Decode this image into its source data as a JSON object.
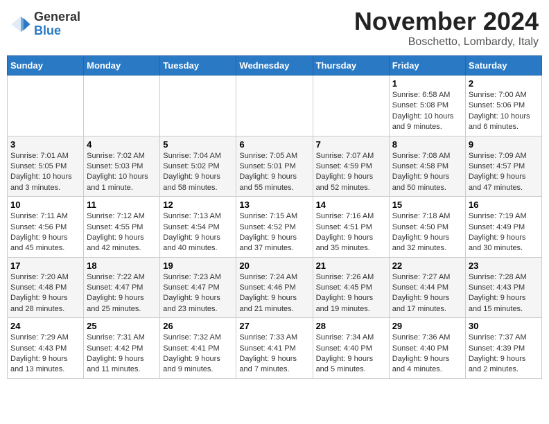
{
  "header": {
    "logo_line1": "General",
    "logo_line2": "Blue",
    "title": "November 2024",
    "subtitle": "Boschetto, Lombardy, Italy"
  },
  "calendar": {
    "days_of_week": [
      "Sunday",
      "Monday",
      "Tuesday",
      "Wednesday",
      "Thursday",
      "Friday",
      "Saturday"
    ],
    "weeks": [
      [
        {
          "day": "",
          "info": ""
        },
        {
          "day": "",
          "info": ""
        },
        {
          "day": "",
          "info": ""
        },
        {
          "day": "",
          "info": ""
        },
        {
          "day": "",
          "info": ""
        },
        {
          "day": "1",
          "info": "Sunrise: 6:58 AM\nSunset: 5:08 PM\nDaylight: 10 hours and 9 minutes."
        },
        {
          "day": "2",
          "info": "Sunrise: 7:00 AM\nSunset: 5:06 PM\nDaylight: 10 hours and 6 minutes."
        }
      ],
      [
        {
          "day": "3",
          "info": "Sunrise: 7:01 AM\nSunset: 5:05 PM\nDaylight: 10 hours and 3 minutes."
        },
        {
          "day": "4",
          "info": "Sunrise: 7:02 AM\nSunset: 5:03 PM\nDaylight: 10 hours and 1 minute."
        },
        {
          "day": "5",
          "info": "Sunrise: 7:04 AM\nSunset: 5:02 PM\nDaylight: 9 hours and 58 minutes."
        },
        {
          "day": "6",
          "info": "Sunrise: 7:05 AM\nSunset: 5:01 PM\nDaylight: 9 hours and 55 minutes."
        },
        {
          "day": "7",
          "info": "Sunrise: 7:07 AM\nSunset: 4:59 PM\nDaylight: 9 hours and 52 minutes."
        },
        {
          "day": "8",
          "info": "Sunrise: 7:08 AM\nSunset: 4:58 PM\nDaylight: 9 hours and 50 minutes."
        },
        {
          "day": "9",
          "info": "Sunrise: 7:09 AM\nSunset: 4:57 PM\nDaylight: 9 hours and 47 minutes."
        }
      ],
      [
        {
          "day": "10",
          "info": "Sunrise: 7:11 AM\nSunset: 4:56 PM\nDaylight: 9 hours and 45 minutes."
        },
        {
          "day": "11",
          "info": "Sunrise: 7:12 AM\nSunset: 4:55 PM\nDaylight: 9 hours and 42 minutes."
        },
        {
          "day": "12",
          "info": "Sunrise: 7:13 AM\nSunset: 4:54 PM\nDaylight: 9 hours and 40 minutes."
        },
        {
          "day": "13",
          "info": "Sunrise: 7:15 AM\nSunset: 4:52 PM\nDaylight: 9 hours and 37 minutes."
        },
        {
          "day": "14",
          "info": "Sunrise: 7:16 AM\nSunset: 4:51 PM\nDaylight: 9 hours and 35 minutes."
        },
        {
          "day": "15",
          "info": "Sunrise: 7:18 AM\nSunset: 4:50 PM\nDaylight: 9 hours and 32 minutes."
        },
        {
          "day": "16",
          "info": "Sunrise: 7:19 AM\nSunset: 4:49 PM\nDaylight: 9 hours and 30 minutes."
        }
      ],
      [
        {
          "day": "17",
          "info": "Sunrise: 7:20 AM\nSunset: 4:48 PM\nDaylight: 9 hours and 28 minutes."
        },
        {
          "day": "18",
          "info": "Sunrise: 7:22 AM\nSunset: 4:47 PM\nDaylight: 9 hours and 25 minutes."
        },
        {
          "day": "19",
          "info": "Sunrise: 7:23 AM\nSunset: 4:47 PM\nDaylight: 9 hours and 23 minutes."
        },
        {
          "day": "20",
          "info": "Sunrise: 7:24 AM\nSunset: 4:46 PM\nDaylight: 9 hours and 21 minutes."
        },
        {
          "day": "21",
          "info": "Sunrise: 7:26 AM\nSunset: 4:45 PM\nDaylight: 9 hours and 19 minutes."
        },
        {
          "day": "22",
          "info": "Sunrise: 7:27 AM\nSunset: 4:44 PM\nDaylight: 9 hours and 17 minutes."
        },
        {
          "day": "23",
          "info": "Sunrise: 7:28 AM\nSunset: 4:43 PM\nDaylight: 9 hours and 15 minutes."
        }
      ],
      [
        {
          "day": "24",
          "info": "Sunrise: 7:29 AM\nSunset: 4:43 PM\nDaylight: 9 hours and 13 minutes."
        },
        {
          "day": "25",
          "info": "Sunrise: 7:31 AM\nSunset: 4:42 PM\nDaylight: 9 hours and 11 minutes."
        },
        {
          "day": "26",
          "info": "Sunrise: 7:32 AM\nSunset: 4:41 PM\nDaylight: 9 hours and 9 minutes."
        },
        {
          "day": "27",
          "info": "Sunrise: 7:33 AM\nSunset: 4:41 PM\nDaylight: 9 hours and 7 minutes."
        },
        {
          "day": "28",
          "info": "Sunrise: 7:34 AM\nSunset: 4:40 PM\nDaylight: 9 hours and 5 minutes."
        },
        {
          "day": "29",
          "info": "Sunrise: 7:36 AM\nSunset: 4:40 PM\nDaylight: 9 hours and 4 minutes."
        },
        {
          "day": "30",
          "info": "Sunrise: 7:37 AM\nSunset: 4:39 PM\nDaylight: 9 hours and 2 minutes."
        }
      ]
    ]
  }
}
